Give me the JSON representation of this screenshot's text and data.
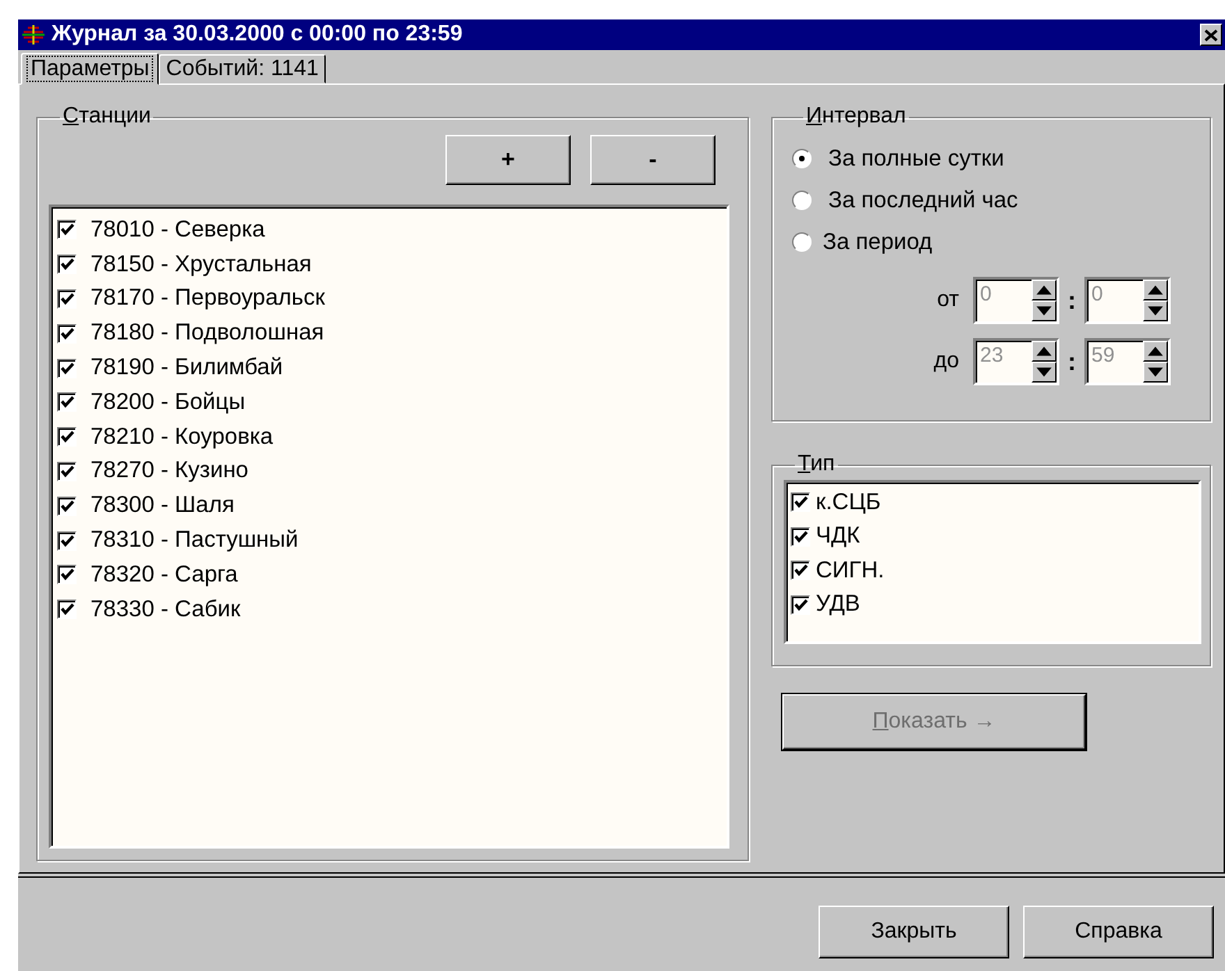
{
  "window": {
    "title": "Журнал за 30.03.2000 с 00:00 по 23:59"
  },
  "tabs": [
    {
      "label": "Параметры",
      "selected": true
    },
    {
      "label": "Событий: 1141",
      "selected": false
    }
  ],
  "stations": {
    "title": "Станции",
    "add_button": "+",
    "remove_button": "-",
    "items": [
      {
        "label": "78010 - Северка",
        "checked": true
      },
      {
        "label": "78150 - Хрустальная",
        "checked": true
      },
      {
        "label": "78170 - Первоуральск",
        "checked": true
      },
      {
        "label": "78180 - Подволошная",
        "checked": true
      },
      {
        "label": "78190 - Билимбай",
        "checked": true
      },
      {
        "label": "78200 - Бойцы",
        "checked": true
      },
      {
        "label": "78210 - Коуровка",
        "checked": true
      },
      {
        "label": "78270 - Кузино",
        "checked": true
      },
      {
        "label": "78300 - Шаля",
        "checked": true
      },
      {
        "label": "78310 - Пастушный",
        "checked": true
      },
      {
        "label": "78320 - Сарга",
        "checked": true
      },
      {
        "label": "78330 - Сабик",
        "checked": true
      }
    ]
  },
  "interval": {
    "title": "Интервал",
    "options": [
      {
        "label": "За полные сутки",
        "selected": true
      },
      {
        "label": "За последний час",
        "selected": false
      },
      {
        "label": "За период",
        "selected": false
      }
    ],
    "from": {
      "label": "от",
      "hours": "0",
      "minutes": "0",
      "disabled": true
    },
    "to": {
      "label": "до",
      "hours": "23",
      "minutes": "59",
      "disabled": true
    },
    "separator": ":"
  },
  "type": {
    "title": "Тип",
    "items": [
      {
        "label": "к.СЦБ",
        "checked": true
      },
      {
        "label": "ЧДК",
        "checked": true
      },
      {
        "label": "СИГН.",
        "checked": true
      },
      {
        "label": "УДВ",
        "checked": true
      }
    ]
  },
  "show_button": {
    "label": "Показать →",
    "disabled": true
  },
  "buttons": [
    "Закрыть",
    "Справка"
  ]
}
